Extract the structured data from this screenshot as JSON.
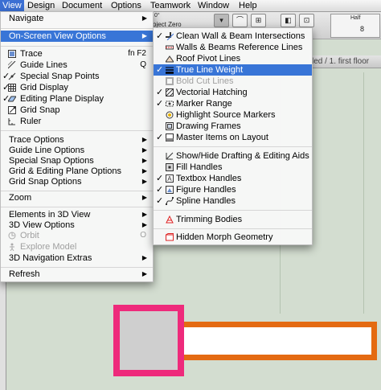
{
  "menubar": {
    "items": [
      "View",
      "Design",
      "Document",
      "Options",
      "Teamwork",
      "Window",
      "Help"
    ]
  },
  "toolbar": {
    "project_zero_text": "oject Zero",
    "degree_text": "0°",
    "half_label": "Half",
    "ribbon_value": "8"
  },
  "canvas": {
    "tab_label": "led / 1. first floor"
  },
  "view_menu": {
    "navigate": "Navigate",
    "on_screen_view_options": "On-Screen View Options",
    "trace": "Trace",
    "trace_shortcut": "fn F2",
    "guide_lines": "Guide Lines",
    "guide_lines_shortcut": "Q",
    "special_snap_points": "Special Snap Points",
    "grid_display": "Grid Display",
    "editing_plane_display": "Editing Plane Display",
    "grid_snap": "Grid Snap",
    "ruler": "Ruler",
    "trace_options": "Trace Options",
    "guide_line_options": "Guide Line Options",
    "special_snap_options": "Special Snap Options",
    "grid_editing_plane_options": "Grid & Editing Plane Options",
    "grid_snap_options": "Grid Snap Options",
    "zoom": "Zoom",
    "elements_in_3d_view": "Elements in 3D View",
    "view_options_3d": "3D View Options",
    "orbit": "Orbit",
    "orbit_shortcut": "O",
    "explore_model": "Explore Model",
    "navigation_extras_3d": "3D Navigation Extras",
    "refresh": "Refresh"
  },
  "submenu": {
    "clean_wall_beam": "Clean Wall & Beam Intersections",
    "walls_beams_reference": "Walls & Beams Reference Lines",
    "roof_pivot_lines": "Roof Pivot Lines",
    "true_line_weight": "True Line Weight",
    "bold_cut_lines": "Bold Cut Lines",
    "vectorial_hatching": "Vectorial Hatching",
    "marker_range": "Marker Range",
    "highlight_source_markers": "Highlight Source Markers",
    "drawing_frames": "Drawing Frames",
    "master_items_on_layout": "Master Items on Layout",
    "show_hide_drafting": "Show/Hide Drafting & Editing Aids",
    "fill_handles": "Fill Handles",
    "textbox_handles": "Textbox Handles",
    "figure_handles": "Figure Handles",
    "spline_handles": "Spline Handles",
    "trimming_bodies": "Trimming Bodies",
    "hidden_morph_geometry": "Hidden Morph Geometry"
  },
  "colors": {
    "highlight": "#3875d7",
    "pink_frame": "#ee2a7b",
    "orange_frame": "#e46a12",
    "canvas": "#d3ddd0"
  },
  "icons": {
    "checkmark": "checkmark-icon",
    "submenu_arrow": "triangle-right-icon"
  }
}
